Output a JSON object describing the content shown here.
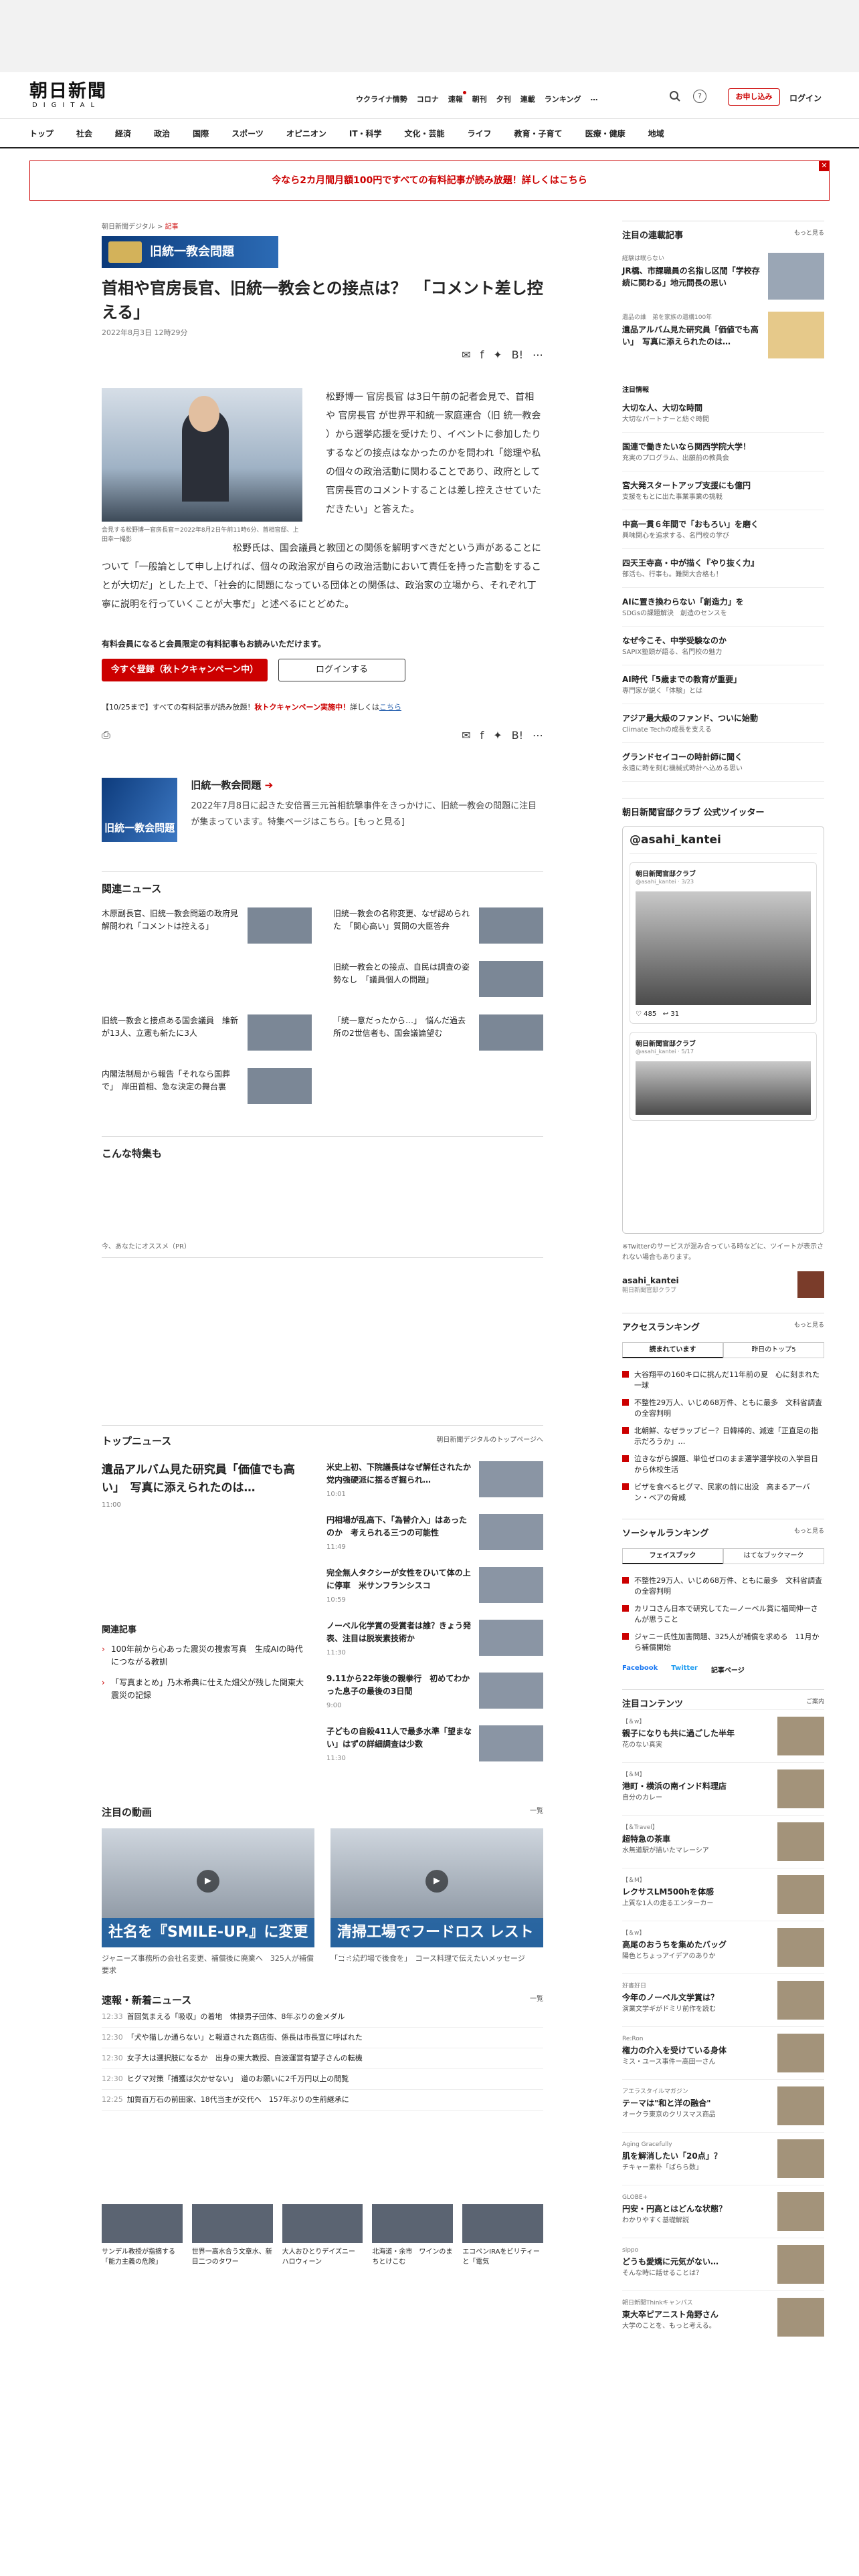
{
  "header": {
    "logo": "朝日新聞",
    "logo_sub": "DIGITAL",
    "topnav": [
      "ウクライナ情勢",
      "コロナ",
      "速報",
      "朝刊",
      "夕刊",
      "連載",
      "ランキング",
      "…"
    ],
    "subscribe": "お申し込み",
    "login": "ログイン",
    "help": "?"
  },
  "catnav": [
    "トップ",
    "社会",
    "経済",
    "政治",
    "国際",
    "スポーツ",
    "オピニオン",
    "IT・科学",
    "文化・芸能",
    "ライフ",
    "教育・子育て",
    "医療・健康",
    "地域"
  ],
  "promo": "今なら2カ月間月額100円ですべての有料記事が読み放題！詳しくはこちら",
  "article": {
    "crumb_site": "朝日新聞デジタル",
    "crumb_sep": ">",
    "crumb_section": "記事",
    "tag_banner": "旧統一教会問題",
    "title": "首相や官房長官、旧統一教会との接点は？　「コメント差し控える」",
    "date": "2022年8月3日 12時29分",
    "caption": "会見する松野博一官房長官＝2022年8月2日午前11時6分、首相官邸、上田幸一撮影",
    "para1": "松野博一 官房長官 は3日午前の記者会見で、首相や 官房長官 が世界平和統一家庭連合（旧 統一教会 ）から選挙応援を受けたり、イベントに参加したりするなどの接点はなかったのかを問われ「総理や私の個々の政治活動に関わることであり、政府として官房長官のコメントすることは差し控えさせていただきたい」と答えた。",
    "para2": "松野氏は、国会議員と教団との関係を解明すべきだという声があることについて「一般論として申し上げれば、個々の政治家が自らの政治活動において責任を持った言動をすることが大切だ」とした上で、「社会的に問題になっている団体との関係は、政治家の立場から、それぞれ丁寧に説明を行っていくことが大事だ」と述べるにとどめた。",
    "member_note": "有料会員になると会員限定の有料記事もお読みいただけます。",
    "register_btn": "今すぐ登録（秋トクキャンペーン中）",
    "login_btn": "ログインする",
    "campaign_pre": "【10/25まで】すべての有料記事が読み放題！",
    "campaign_red": "秋トクキャンペーン実施中！",
    "campaign_mid": "詳しくは",
    "campaign_link": "こちら",
    "share_count_a": "list",
    "share_count_b": "4"
  },
  "feature": {
    "img_label": "旧統一教会問題",
    "title": "旧統一教会問題",
    "desc": "2022年7月8日に起きた安倍晋三元首相銃撃事件をきっかけに、旧統一教会の問題に注目が集まっています。特集ページはこちら。[もっと見る]"
  },
  "related_news": {
    "heading": "関連ニュース",
    "items": [
      "木原副長官、旧統一教会問題の政府見解問われ「コメントは控える」",
      "旧統一教会の名称変更、なぜ認められた　「関心高い」質問の大臣答弁",
      "",
      "旧統一教会との接点、自民は調査の姿勢なし　「議員個人の問題」",
      "旧統一教会と接点ある国会議員　維新が13人、立憲も新たに3人",
      "「統一意だったから…」　悩んだ過去所の2世信者も、国会議論望む",
      "内閣法制局から報告「それなら国葬で」　岸田首相、急な決定の舞台裏"
    ]
  },
  "specials": {
    "heading": "こんな特集も",
    "pr": "今、あなたにオススメ（PR）"
  },
  "top_news": {
    "heading": "トップニュース",
    "link": "朝日新聞デジタルのトップページへ",
    "main": "遺品アルバム見た研究員「価値でも高い」　写真に添えられたのは…",
    "main_time": "11:00",
    "related_heading": "関連記事",
    "related": [
      "100年前から心あった震災の捜索写真　生成AIの時代につながる教訓",
      "「写真まとめ」乃木希典に仕えた畑父が残した関東大震災の記録"
    ],
    "items": [
      {
        "title": "米史上初、下院議長はなぜ解任されたか　党内強硬派に揺るぎ掘られ…",
        "time": "10:01"
      },
      {
        "title": "円相場が乱高下、「為替介入」はあったのか　考えられる三つの可能性",
        "time": "11:49"
      },
      {
        "title": "完全無人タクシーが女性をひいて体の上に停車　米サンフランシスコ",
        "time": "10:59"
      },
      {
        "title": "ノーベル化学賞の受賞者は誰？きょう発表、注目は脱炭素技術か",
        "time": "11:30"
      },
      {
        "title": "9.11から22年後の親拳行　初めてわかった息子の最後の3日間",
        "time": "9:00"
      },
      {
        "title": "子どもの自殺411人で最多水準「望まない」はずの詳細調査は少数",
        "time": "11:30"
      }
    ]
  },
  "videos": {
    "heading": "注目の動画",
    "more": "一覧",
    "items": [
      {
        "banner": "社名を『SMILE-UP.』に変更",
        "cap": "ジャニーズ事務所の会社名変更、補償後に廃業へ　325人が補償要求"
      },
      {
        "banner": "清掃工場でフードロス レストラン",
        "cap": "「ゴミ焼却場で後食を」　コース料理で伝えたいメッセージ"
      }
    ]
  },
  "quick": {
    "heading": "速報・新着ニュース",
    "more": "一覧",
    "items": [
      {
        "time": "12:33",
        "text": "首回気まえる「吸収」の着地　体操男子団体、8年ぶりの金メダル"
      },
      {
        "time": "12:30",
        "text": "「犬や猫しか通らない」と報道された商店街、係長は市長宣に呼ばれた"
      },
      {
        "time": "12:30",
        "text": "女子大は選択肢になるか　出身の東大教授、自波運営有望子さんの転機"
      },
      {
        "time": "12:30",
        "text": "ヒグマ対策「捕獲は欠かせない」　道のお願いに2千万円以上の間覧"
      },
      {
        "time": "12:25",
        "text": "加賀百万石の前田家、18代当主が交代へ　157年ぶりの生前継承に"
      }
    ]
  },
  "thumbs": [
    "サンデル教授が指摘する「能力主義の危険」",
    "世界一高水合う文章水、新目二つのタワー",
    "大人おひとりデイズニー　ハロウィーン",
    "北海道・余市　ワインのまちとけこむ",
    "エコペンIRAをビリティーと「電気"
  ],
  "side": {
    "rensai_head": "注目の連載記事",
    "more": "もっと見る",
    "rensai": [
      {
        "small": "経験は眠らない",
        "title": "JR橋、市課職員の名指し区間「学校存続に関わる」地元問長の思い"
      },
      {
        "small": "遺品の誰　弟を家族の遺構100年",
        "title": "遺品アルバム見た研究員「価値でも高い」　写真に添えられたのは…"
      }
    ],
    "ad_head": "注目情報",
    "ads": [
      {
        "t": "大切な人、大切な時間",
        "s": "大切なパートナーと紡ぐ時間"
      },
      {
        "t": "国連で働きたいなら関西学院大学！",
        "s": "充実のプログラム、出願前の教員会"
      },
      {
        "t": "宮大発スタートアップ支援にも億円",
        "s": "支援をもとに出た事業事業の挑戦"
      },
      {
        "t": "中高一貫６年間で「おもろい」を磨く",
        "s": "興味関心を追求する、名門校の学び"
      },
      {
        "t": "四天王寺高・中が描く『やり抜く力』",
        "s": "部活も、行事も。難関大合格も！"
      },
      {
        "t": "AIに置き換わらない「創造力」を",
        "s": "SDGsの課題解決　創造のセンスを"
      },
      {
        "t": "なぜ今こそ、中学受験なのか",
        "s": "SAPIX塾頭が語る、名門校の魅力"
      },
      {
        "t": "AI時代「5歳までの教育が重要」",
        "s": "専門家が説く「体験」とは"
      },
      {
        "t": "アジア最大級のファンド、ついに始動",
        "s": "Climate Techの成長を支える"
      },
      {
        "t": "グランドセイコーの時計師に聞く",
        "s": "永遠に時を刻む機械式時計へ込める思い"
      }
    ],
    "tw_head": "朝日新聞官邸クラブ 公式ツイッター",
    "tw_handle": "@asahi_kantei",
    "tw_name": "朝日新聞官邸クラブ",
    "tw_user": "@asahi_kantei",
    "tw_time1": "3/23",
    "tw_time2": "5/17",
    "tw_likes": "485",
    "tw_reply": "31",
    "tw_note": "※Twitterのサービスが混み合っている時などに、ツイートが表示されない場合もあります。",
    "tw_acc": "asahi_kantei",
    "tw_acc_sub": "朝日新聞官邸クラブ",
    "rank_head": "アクセスランキング",
    "tab1": "読まれています",
    "tab2": "昨日のトップ5",
    "ranking": [
      "大谷翔平の160キロに挑んだ11年前の夏　心に刻まれた一球",
      "不整性29万人、いじめ68万件、ともに最多　文科省調査の全容判明",
      "北朝鮮、なぜラップビー？日韓棒的、減速「正直足の指示だろうか」…",
      "泣きながら課題、単位ゼロのまま選学選学校の入学目日から休校生活",
      "ビザを食べるヒグマ、民家の前に出没　高まるアーバン・ベアの脅威"
    ],
    "social_head": "ソーシャルランキング",
    "stab1": "フェイスブック",
    "stab2": "はてなブックマーク",
    "social": [
      "不整性29万人、いじめ68万件、ともに最多　文科省調査の全容判明",
      "カリコさん日本で研究してた—ノーベル賞に福岡伸一さんが思うこと",
      "ジャニー氏性加害問題、325人が補償を求める　11月から補償開始"
    ],
    "fb": "Facebook",
    "tw": "Twitter",
    "more2": "記事ページ",
    "contents_head": "注目コンテンツ",
    "contents_more": "ご案内",
    "contents": [
      {
        "s": "【＆w】",
        "t": "親子になりも共に過ごした半年",
        "e": "花のない真実"
      },
      {
        "s": "【＆M】",
        "t": "港町・横浜の南インド料理店",
        "e": "自分のカレー"
      },
      {
        "s": "【＆Travel】",
        "t": "超特急の茶車",
        "e": "水無道駅が描いたマレーシア"
      },
      {
        "s": "【＆M】",
        "t": "レクサスLM500hを体感",
        "e": "上質な1人の走るエンターカー"
      },
      {
        "s": "【＆w】",
        "t": "高尾のおうちを集めたバッグ",
        "e": "陽色とちょっアイデアのありか"
      },
      {
        "s": "好書好日",
        "t": "今年のノーベル文学賞は？",
        "e": "演業文学ギがドミリ前作を読む"
      },
      {
        "s": "Re:Ron",
        "t": "権力の介入を受けている身体",
        "e": "ミス・ユース事件ー高田一さん"
      },
      {
        "s": "アエラスタイルマガジン",
        "t": "テーマは\"和と洋の融合\"",
        "e": "オークラ東京のクリスマス商品"
      },
      {
        "s": "Aging Gracefully",
        "t": "肌を解消したい「20点」？",
        "e": "チキャー素朴「ばらら数」"
      },
      {
        "s": "GLOBE+",
        "t": "円安・円高とはどんな状態？",
        "e": "わかりやすく基礎解説"
      },
      {
        "s": "sippo",
        "t": "どうも愛嬌に元気がない…",
        "e": "そんな時に話せることは？"
      },
      {
        "s": "朝日新聞Thinkキャンパス",
        "t": "東大卒ピアニスト角野さん",
        "e": "大学のことを、もっと考える。"
      }
    ]
  }
}
